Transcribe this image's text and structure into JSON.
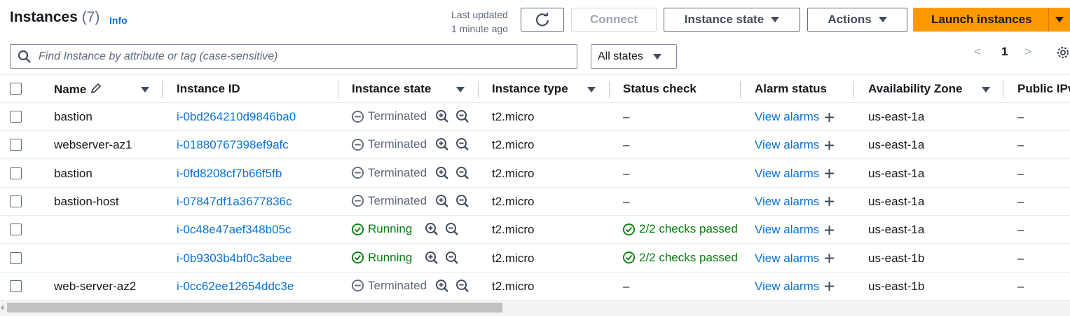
{
  "header": {
    "title": "Instances",
    "count": "(7)",
    "info": "Info",
    "last_updated_line1": "Last updated",
    "last_updated_line2": "1 minute ago",
    "connect_label": "Connect",
    "instance_state_label": "Instance state",
    "actions_label": "Actions",
    "launch_label": "Launch instances"
  },
  "filter": {
    "search_placeholder": "Find Instance by attribute or tag (case-sensitive)",
    "states_selected": "All states"
  },
  "pagination": {
    "prev": "<",
    "page": "1",
    "next": ">"
  },
  "columns": [
    "Name",
    "Instance ID",
    "Instance state",
    "Instance type",
    "Status check",
    "Alarm status",
    "Availability Zone",
    "Public IPv"
  ],
  "rows": [
    {
      "name": "bastion",
      "id": "i-0bd264210d9846ba0",
      "state": "Terminated",
      "type": "t2.micro",
      "status": "–",
      "alarm": "View alarms",
      "az": "us-east-1a",
      "ip": "–"
    },
    {
      "name": "webserver-az1",
      "id": "i-01880767398ef9afc",
      "state": "Terminated",
      "type": "t2.micro",
      "status": "–",
      "alarm": "View alarms",
      "az": "us-east-1a",
      "ip": "–"
    },
    {
      "name": "bastion",
      "id": "i-0fd8208cf7b66f5fb",
      "state": "Terminated",
      "type": "t2.micro",
      "status": "–",
      "alarm": "View alarms",
      "az": "us-east-1a",
      "ip": "–"
    },
    {
      "name": "bastion-host",
      "id": "i-07847df1a3677836c",
      "state": "Terminated",
      "type": "t2.micro",
      "status": "–",
      "alarm": "View alarms",
      "az": "us-east-1a",
      "ip": "–"
    },
    {
      "name": "",
      "id": "i-0c48e47aef348b05c",
      "state": "Running",
      "type": "t2.micro",
      "status": "2/2 checks passed",
      "alarm": "View alarms",
      "az": "us-east-1a",
      "ip": "–"
    },
    {
      "name": "",
      "id": "i-0b9303b4bf0c3abee",
      "state": "Running",
      "type": "t2.micro",
      "status": "2/2 checks passed",
      "alarm": "View alarms",
      "az": "us-east-1b",
      "ip": "–"
    },
    {
      "name": "web-server-az2",
      "id": "i-0cc62ee12654ddc3e",
      "state": "Terminated",
      "type": "t2.micro",
      "status": "–",
      "alarm": "View alarms",
      "az": "us-east-1b",
      "ip": "–"
    }
  ],
  "colors": {
    "link": "#0972d3",
    "running": "#037f0c",
    "terminated": "#5f6b7a",
    "primary": "#ff9900"
  }
}
